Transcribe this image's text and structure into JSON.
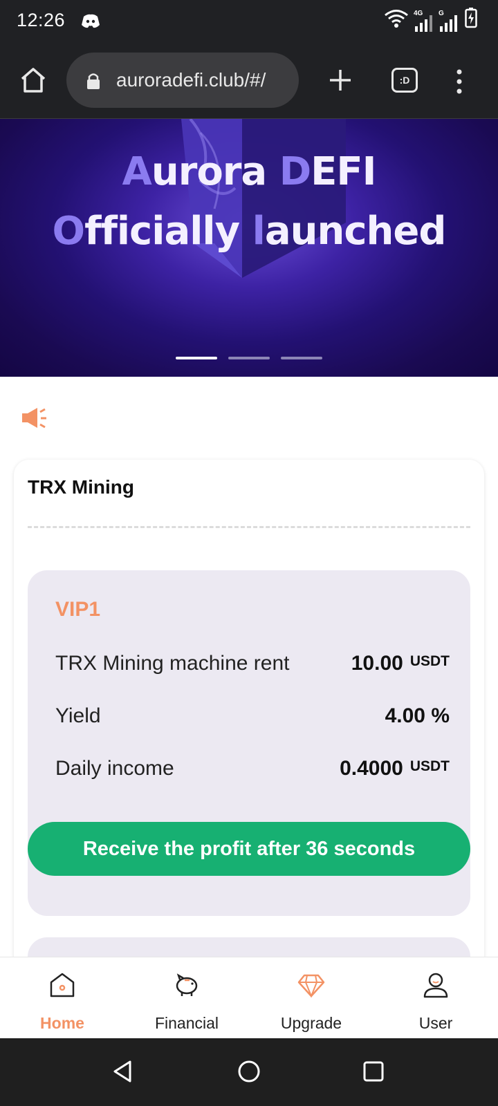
{
  "status_bar": {
    "time": "12:26",
    "icons": [
      "discord-icon",
      "wifi-icon",
      "signal-4g-icon",
      "signal-g-icon",
      "battery-charging-icon"
    ],
    "network_label_1": "4G",
    "network_label_2": "G"
  },
  "browser": {
    "url": "auroradefi.club/#/",
    "tab_count_label": ":D"
  },
  "banner": {
    "line1_accent": "A",
    "line1_rest": "urora ",
    "line1_accent2": "D",
    "line1_rest2": "EFI",
    "line2_accent": "O",
    "line2_rest": "fficially ",
    "line2_accent2": "l",
    "line2_rest2": "aunched",
    "slide_count": 3,
    "active_slide": 1
  },
  "card": {
    "title": "TRX Mining",
    "plan": {
      "level": "VIP1",
      "rows": [
        {
          "label": "TRX Mining machine rent",
          "value": "10.00",
          "unit": "USDT"
        },
        {
          "label": "Yield",
          "value": "4.00 %",
          "unit": ""
        },
        {
          "label": "Daily income",
          "value": "0.4000",
          "unit": "USDT"
        }
      ],
      "button_label": "Receive the profit after 36 seconds"
    }
  },
  "nav": {
    "items": [
      {
        "label": "Home",
        "icon": "home-icon",
        "active": true
      },
      {
        "label": "Financial",
        "icon": "piggy-bank-icon",
        "active": false
      },
      {
        "label": "Upgrade",
        "icon": "diamond-icon",
        "active": false
      },
      {
        "label": "User",
        "icon": "user-icon",
        "active": false
      }
    ]
  },
  "colors": {
    "accent": "#f39264",
    "button_green": "#17b072",
    "plan_bg": "#ece9f2",
    "banner_purple": "#231173"
  }
}
